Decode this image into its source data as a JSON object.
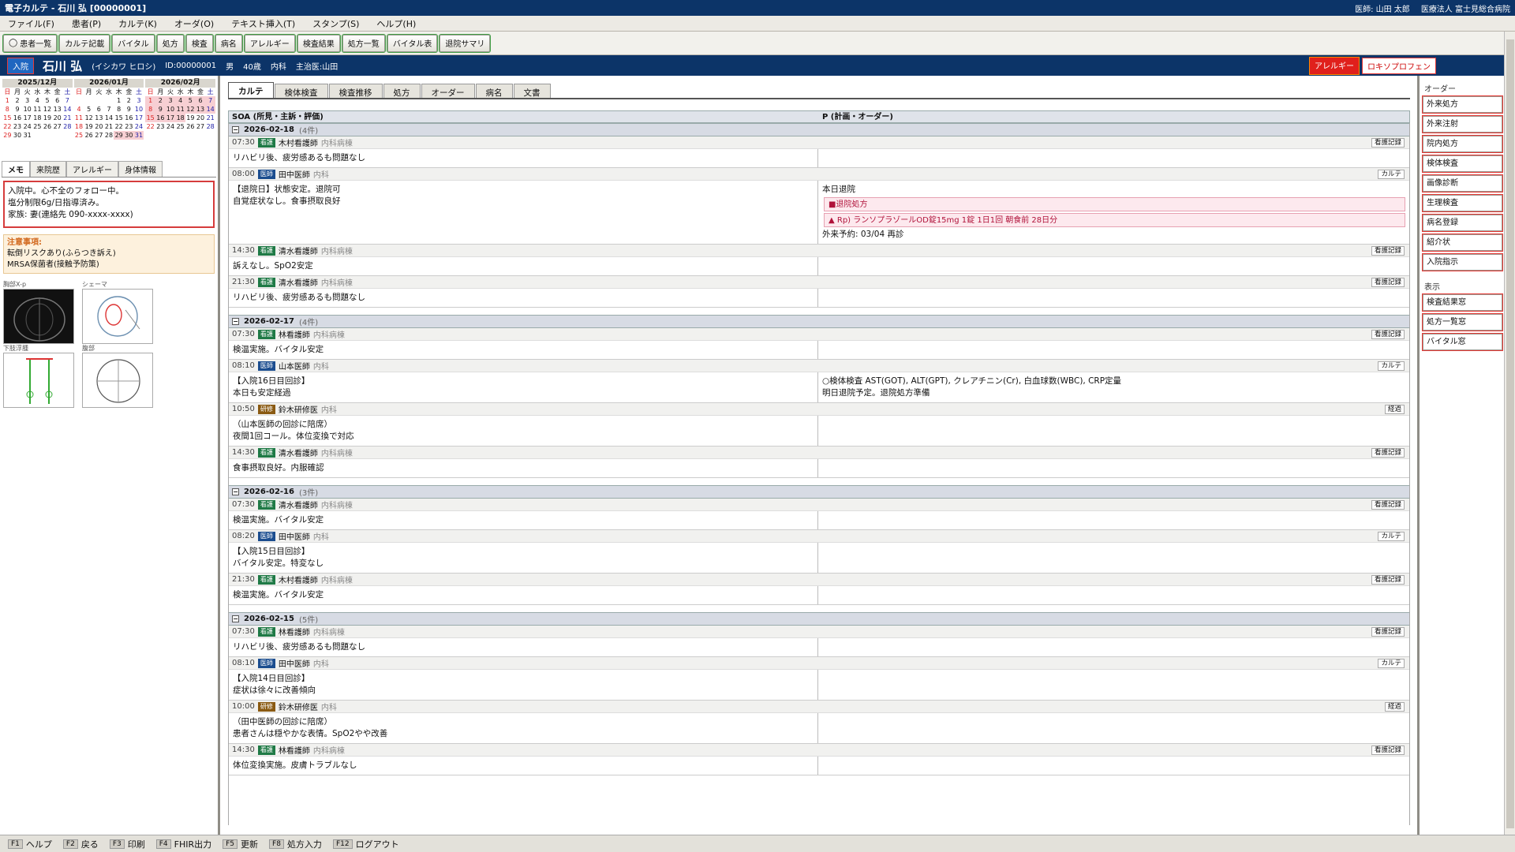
{
  "window": {
    "title": "電子カルテ - 石川 弘 [00000001]",
    "doctor": "医師: 山田 太郎",
    "org": "医療法人 富士見総合病院"
  },
  "menu": [
    "ファイル(F)",
    "患者(P)",
    "カルテ(K)",
    "オーダ(O)",
    "テキスト挿入(T)",
    "スタンプ(S)",
    "ヘルプ(H)"
  ],
  "toolbar": [
    "患者一覧",
    "カルテ記載",
    "バイタル",
    "処方",
    "検査",
    "病名",
    "アレルギー",
    "検査結果",
    "処方一覧",
    "バイタル表",
    "退院サマリ"
  ],
  "patient": {
    "status": "入院",
    "name": "石川 弘",
    "kana": "(イシカワ ヒロシ)",
    "id": "ID:00000001",
    "sex": "男",
    "age": "40歳",
    "dept": "内科",
    "attending": "主治医:山田",
    "alert1": "アレルギー",
    "alert2": "ロキソプロフェン"
  },
  "calendar": {
    "weekdays": [
      "日",
      "月",
      "火",
      "水",
      "木",
      "金",
      "土"
    ],
    "months": [
      {
        "label": "2025/12月",
        "lead": 0,
        "days": 31
      },
      {
        "label": "2026/01月",
        "lead": 4,
        "days": 31
      },
      {
        "label": "2026/02月",
        "lead": 0,
        "days": 28
      }
    ]
  },
  "left_tabs": [
    "メモ",
    "来院歴",
    "アレルギー",
    "身体情報"
  ],
  "memo": [
    "入院中。心不全のフォロー中。",
    "塩分制限6g/日指導済み。",
    "家族: 妻(連絡先 090-xxxx-xxxx)"
  ],
  "caution": {
    "title": "注意事項:",
    "lines": [
      "転倒リスクあり(ふらつき訴え)",
      "MRSA保菌者(接触予防策)"
    ]
  },
  "images": [
    {
      "label": "胸部X-p"
    },
    {
      "label": "シェーマ"
    },
    {
      "label": "下肢浮腫"
    },
    {
      "label": "腹部"
    }
  ],
  "center_tabs": [
    "カルテ",
    "検体検査",
    "検査推移",
    "処方",
    "オーダー",
    "病名",
    "文書"
  ],
  "columns": {
    "soa": "SOA (所見・主訴・評価)",
    "plan": "P (計画・オーダー)"
  },
  "days": [
    {
      "date": "2026-02-18",
      "count": "(4件)",
      "entries": [
        {
          "time": "07:30",
          "role": "看護",
          "rc": "kg",
          "author": "木村看護師",
          "dept": "内科病棟",
          "tag": "看護記録",
          "soa": "リハビリ後、疲労感あるも問題なし",
          "plan": []
        },
        {
          "time": "08:00",
          "role": "医師",
          "rc": "ii",
          "author": "田中医師",
          "dept": "内科",
          "tag": "カルテ",
          "soa": "【退院日】状態安定。退院可\n自覚症状なし。食事摂取良好",
          "plan": [
            {
              "t": "本日退院"
            },
            {
              "t": "■退院処方",
              "box": 1
            },
            {
              "t": "▲ Rp) ランソプラゾールOD錠15mg 1錠 1日1回 朝食前 28日分",
              "box": 1
            },
            {
              "t": "外来予約: 03/04 再診"
            }
          ]
        },
        {
          "time": "14:30",
          "role": "看護",
          "rc": "kg",
          "author": "清水看護師",
          "dept": "内科病棟",
          "tag": "看護記録",
          "soa": "訴えなし。SpO2安定",
          "plan": []
        },
        {
          "time": "21:30",
          "role": "看護",
          "rc": "kg",
          "author": "清水看護師",
          "dept": "内科病棟",
          "tag": "看護記録",
          "soa": "リハビリ後、疲労感あるも問題なし",
          "plan": []
        }
      ]
    },
    {
      "date": "2026-02-17",
      "count": "(4件)",
      "entries": [
        {
          "time": "07:30",
          "role": "看護",
          "rc": "kg",
          "author": "林看護師",
          "dept": "内科病棟",
          "tag": "看護記録",
          "soa": "検温実施。バイタル安定",
          "plan": []
        },
        {
          "time": "08:10",
          "role": "医師",
          "rc": "ii",
          "author": "山本医師",
          "dept": "内科",
          "tag": "カルテ",
          "soa": "【入院16日目回診】\n本日も安定経過",
          "plan": [
            {
              "t": "○検体検査 AST(GOT), ALT(GPT), クレアチニン(Cr), 白血球数(WBC), CRP定量"
            },
            {
              "t": "明日退院予定。退院処方準備"
            }
          ]
        },
        {
          "time": "10:50",
          "role": "研修",
          "rc": "ks",
          "author": "鈴木研修医",
          "dept": "内科",
          "tag": "経過",
          "soa": "（山本医師の回診に陪席）\n夜間1回コール。体位変換で対応",
          "plan": []
        },
        {
          "time": "14:30",
          "role": "看護",
          "rc": "kg",
          "author": "清水看護師",
          "dept": "内科病棟",
          "tag": "看護記録",
          "soa": "食事摂取良好。内服確認",
          "plan": []
        }
      ]
    },
    {
      "date": "2026-02-16",
      "count": "(3件)",
      "entries": [
        {
          "time": "07:30",
          "role": "看護",
          "rc": "kg",
          "author": "清水看護師",
          "dept": "内科病棟",
          "tag": "看護記録",
          "soa": "検温実施。バイタル安定",
          "plan": []
        },
        {
          "time": "08:20",
          "role": "医師",
          "rc": "ii",
          "author": "田中医師",
          "dept": "内科",
          "tag": "カルテ",
          "soa": "【入院15日目回診】\nバイタル安定。特変なし",
          "plan": []
        },
        {
          "time": "21:30",
          "role": "看護",
          "rc": "kg",
          "author": "木村看護師",
          "dept": "内科病棟",
          "tag": "看護記録",
          "soa": "検温実施。バイタル安定",
          "plan": []
        }
      ]
    },
    {
      "date": "2026-02-15",
      "count": "(5件)",
      "entries": [
        {
          "time": "07:30",
          "role": "看護",
          "rc": "kg",
          "author": "林看護師",
          "dept": "内科病棟",
          "tag": "看護記録",
          "soa": "リハビリ後、疲労感あるも問題なし",
          "plan": []
        },
        {
          "time": "08:10",
          "role": "医師",
          "rc": "ii",
          "author": "田中医師",
          "dept": "内科",
          "tag": "カルテ",
          "soa": "【入院14日目回診】\n症状は徐々に改善傾向",
          "plan": []
        },
        {
          "time": "10:00",
          "role": "研修",
          "rc": "ks",
          "author": "鈴木研修医",
          "dept": "内科",
          "tag": "経過",
          "soa": "（田中医師の回診に陪席）\n患者さんは穏やかな表情。SpO2やや改善",
          "plan": []
        },
        {
          "time": "14:30",
          "role": "看護",
          "rc": "kg",
          "author": "林看護師",
          "dept": "内科病棟",
          "tag": "看護記録",
          "soa": "体位変換実施。皮膚トラブルなし",
          "plan": []
        }
      ]
    }
  ],
  "right": {
    "order_title": "オーダー",
    "orders": [
      "外来処方",
      "外来注射",
      "院内処方",
      "検体検査",
      "画像診断",
      "生理検査",
      "病名登録",
      "紹介状",
      "入院指示"
    ],
    "view_title": "表示",
    "views": [
      "検査結果窓",
      "処方一覧窓",
      "バイタル窓"
    ]
  },
  "footer": [
    {
      "k": "F1",
      "l": "ヘルプ"
    },
    {
      "k": "F2",
      "l": "戻る"
    },
    {
      "k": "F3",
      "l": "印刷"
    },
    {
      "k": "F4",
      "l": "FHIR出力"
    },
    {
      "k": "F5",
      "l": "更新"
    },
    {
      "k": "F8",
      "l": "処方入力"
    },
    {
      "k": "F12",
      "l": "ログアウト"
    }
  ]
}
